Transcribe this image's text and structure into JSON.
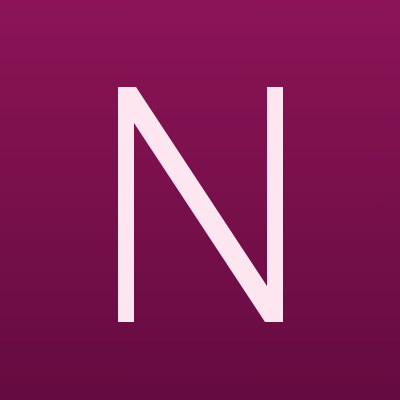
{
  "app_icon": {
    "letter": "N",
    "background_top_color": "#8c1456",
    "background_bottom_color": "#650b41",
    "letter_color": "#fde6f0"
  }
}
